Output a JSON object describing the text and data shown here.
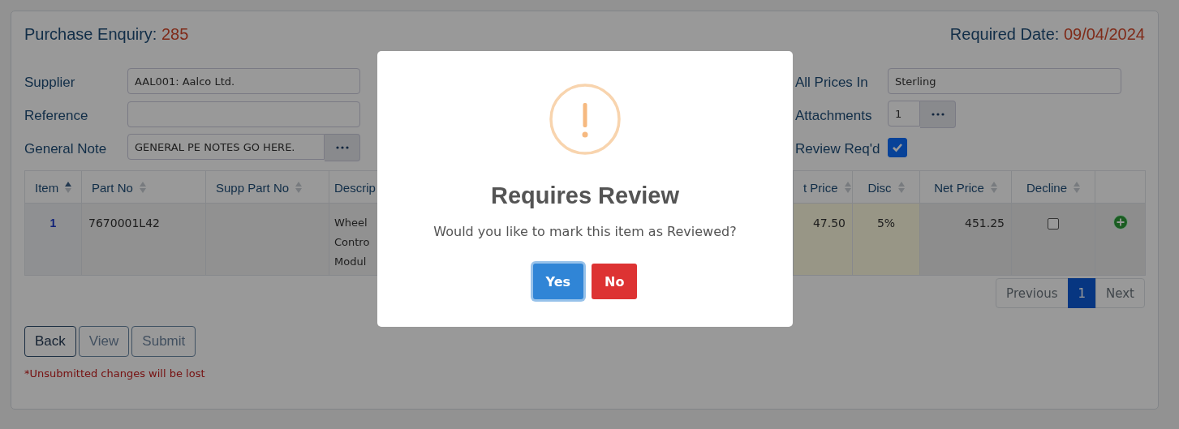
{
  "header": {
    "title_label": "Purchase Enquiry:",
    "number": "285",
    "date_label": "Required Date:",
    "date": "09/04/2024"
  },
  "fields_left": [
    {
      "label": "Supplier",
      "kind": "text",
      "value": "AAL001: Aalco Ltd."
    },
    {
      "label": "Reference",
      "kind": "text"
    },
    {
      "label": "General Note",
      "kind": "picker",
      "value": "GENERAL PE NOTES GO HERE."
    }
  ],
  "fields_right": [
    {
      "label": "All Prices In",
      "kind": "text",
      "value": "Sterling"
    },
    {
      "label": "Attachments",
      "kind": "picker",
      "value": "1"
    },
    {
      "label": "Review Req'd",
      "kind": "checkbox",
      "checked": true
    }
  ],
  "table": {
    "columns": [
      {
        "label": "Item",
        "sorted": true
      },
      {
        "label": "Part No",
        "sorted": false
      },
      {
        "label": "Supp Part No",
        "sorted": false
      },
      {
        "label": "Descrip"
      },
      {
        "label": "t Price",
        "sorted": false
      },
      {
        "label": "Disc",
        "sorted": false
      },
      {
        "label": "Net Price",
        "sorted": false
      },
      {
        "label": "Decline",
        "sorted": false
      }
    ],
    "rows": [
      {
        "item": "1",
        "part_no": "7670001L42",
        "description": "Wheel Contro Modul",
        "unit_price": "47.50",
        "disc": "5%",
        "net_price": "451.25",
        "declined": false
      }
    ]
  },
  "pagination": {
    "previous": "Previous",
    "pages": [
      {
        "label": "1",
        "selected": true
      }
    ],
    "next": "Next"
  },
  "buttons": [
    {
      "label": "Back",
      "disabled": false
    },
    {
      "label": "View",
      "disabled": true
    },
    {
      "label": "Submit",
      "disabled": true
    }
  ],
  "warning": "*Unsubmitted changes will be lost",
  "dialog": {
    "title": "Requires Review",
    "message": "Would you like to mark this item as Reviewed?",
    "buttons": [
      {
        "label": "Yes",
        "kind": "confirm"
      },
      {
        "label": "No",
        "kind": "cancel"
      }
    ]
  }
}
